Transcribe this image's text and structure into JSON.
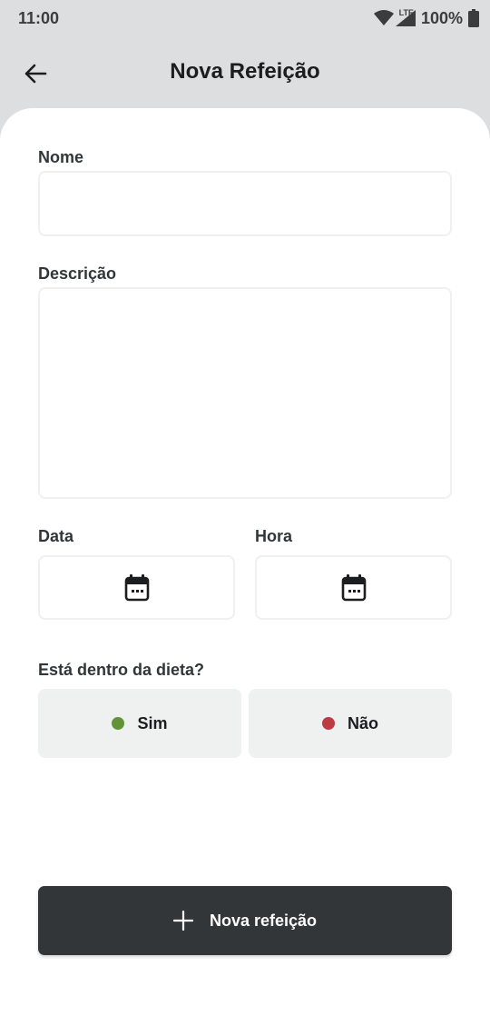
{
  "status_bar": {
    "time": "11:00",
    "network": "LTE",
    "battery": "100%",
    "icons": [
      "wifi-icon",
      "signal-icon",
      "battery-icon"
    ]
  },
  "header": {
    "title": "Nova Refeição",
    "back_icon": "arrow-left-icon"
  },
  "form": {
    "name_label": "Nome",
    "name_value": "",
    "description_label": "Descrição",
    "description_value": "",
    "date_label": "Data",
    "time_label": "Hora",
    "date_icon": "calendar-icon",
    "time_icon": "calendar-icon",
    "diet_question": "Está dentro da dieta?",
    "diet_options": [
      {
        "label": "Sim",
        "color": "#639339"
      },
      {
        "label": "Não",
        "color": "#bf3b44"
      }
    ],
    "submit_label": "Nova refeição",
    "submit_icon": "plus-icon"
  },
  "colors": {
    "header_bg": "#dddee0",
    "sheet_bg": "#ffffff",
    "field_border": "#eff0f0",
    "button_dark": "#333638",
    "option_bg": "#eff0f0"
  }
}
